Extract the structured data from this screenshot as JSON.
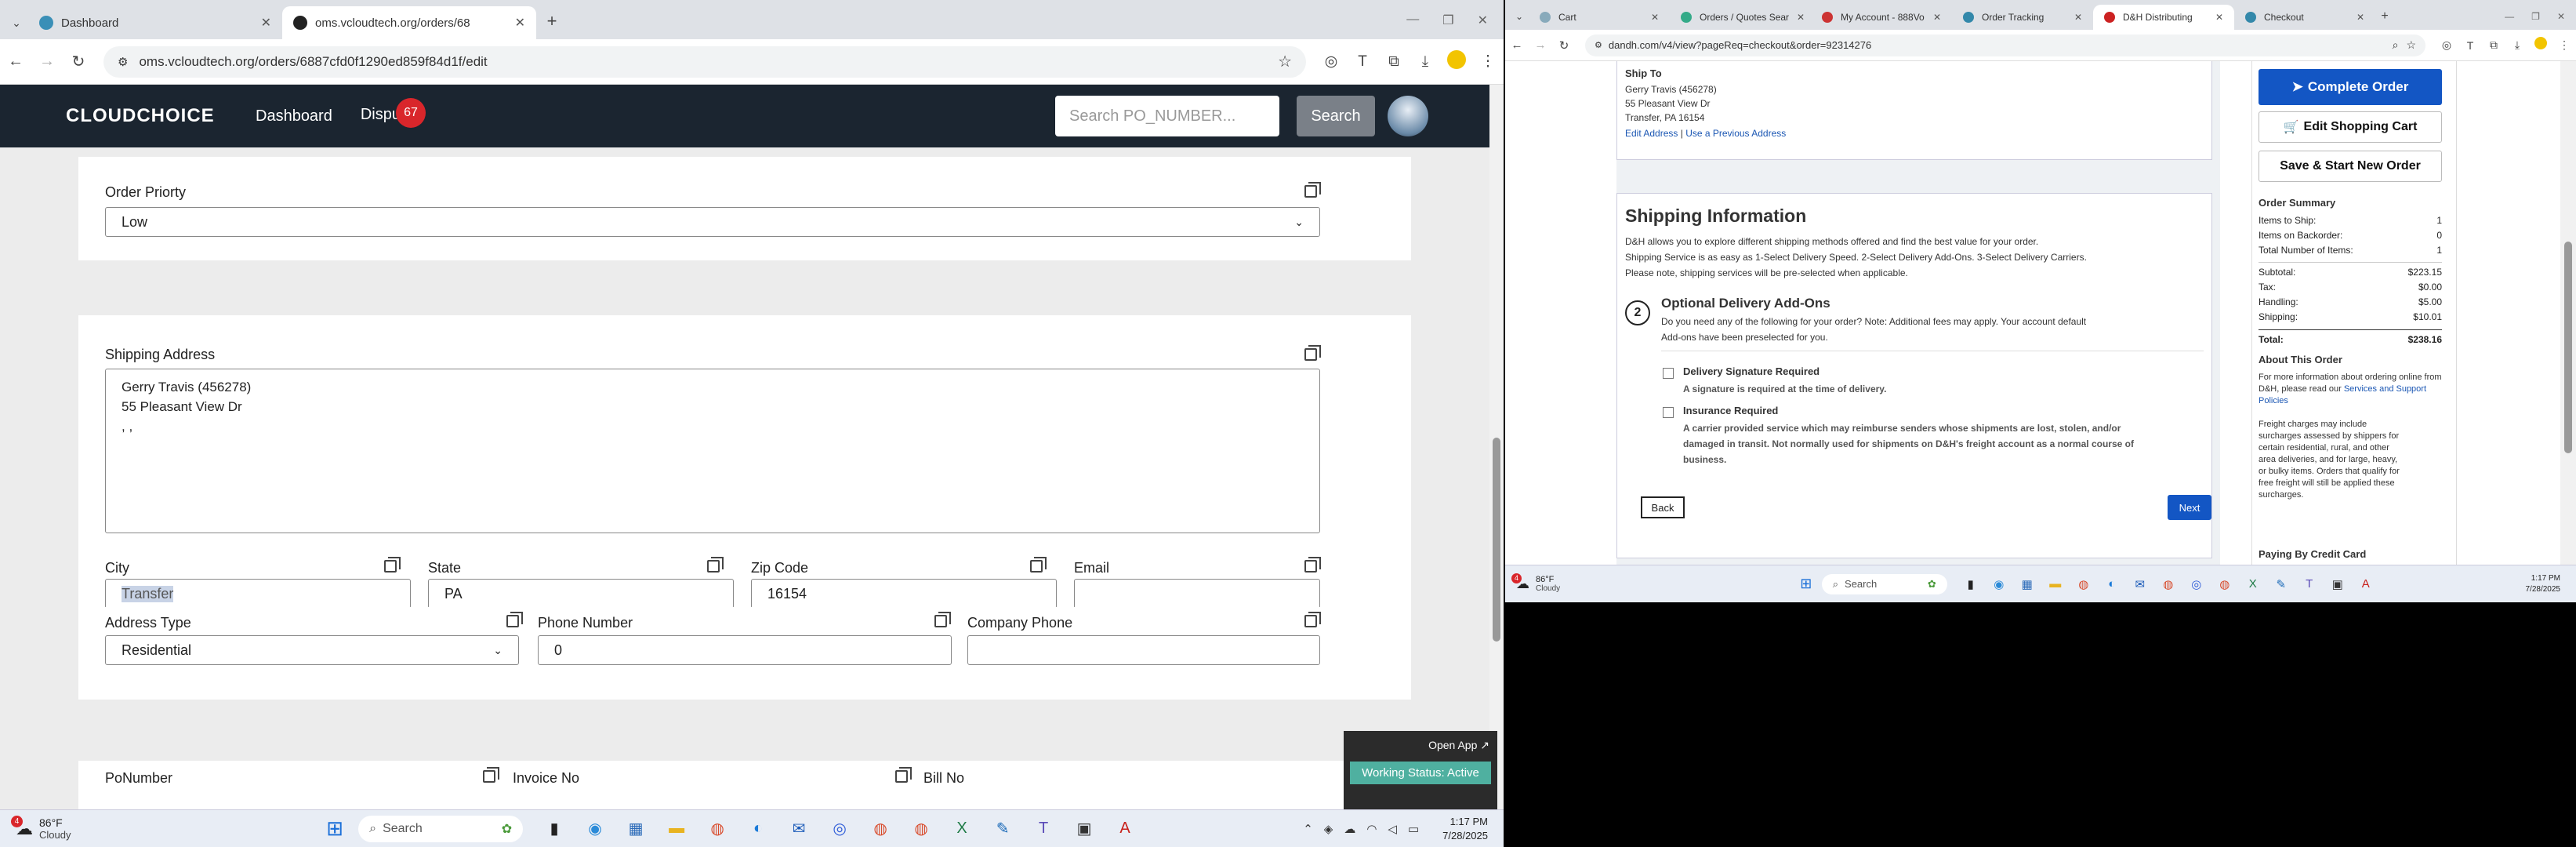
{
  "left": {
    "tabs": [
      {
        "label": "Dashboard",
        "active": false
      },
      {
        "label": "oms.vcloudtech.org/orders/68",
        "active": true
      }
    ],
    "url": "oms.vcloudtech.org/orders/6887cfd0f1290ed859f84d1f/edit",
    "header": {
      "logo": "CLOUDCHOICE",
      "nav_dashboard": "Dashboard",
      "nav_disputes": "Dispu",
      "disputes_count": "67",
      "search_placeholder": "Search PO_NUMBER...",
      "search_button": "Search"
    },
    "order_priority": {
      "label": "Order Priorty",
      "value": "Low"
    },
    "shipping": {
      "label": "Shipping Address",
      "line1": "Gerry Travis (456278)",
      "line2": "55 Pleasant View Dr",
      "line3": ", ,",
      "city_label": "City",
      "city_value": "Transfer",
      "state_label": "State",
      "state_value": "PA",
      "zip_label": "Zip Code",
      "zip_value": "16154",
      "email_label": "Email",
      "email_value": "",
      "address_type_label": "Address Type",
      "address_type_value": "Residential",
      "phone_label": "Phone Number",
      "phone_value": "0",
      "company_phone_label": "Company Phone",
      "company_phone_value": ""
    },
    "bottom_labels": {
      "po": "PoNumber",
      "invoice": "Invoice No",
      "bill": "Bill No"
    },
    "float_panel": {
      "open_app": "Open App ↗",
      "status": "Working Status: Active"
    },
    "taskbar": {
      "temp": "86°F",
      "cond": "Cloudy",
      "search": "Search",
      "time": "1:17 PM",
      "date": "7/28/2025",
      "weather_badge": "4"
    }
  },
  "right": {
    "tabs": [
      "Cart",
      "Orders / Quotes Sear",
      "My Account - 888Vo",
      "Order Tracking",
      "D&H Distributing",
      "Checkout"
    ],
    "active_tab_index": 4,
    "url": "dandh.com/v4/view?pageReq=checkout&order=92314276",
    "ship_to": {
      "title": "Ship To",
      "line1": "Gerry Travis (456278)",
      "line2": "55 Pleasant View Dr",
      "line3": "Transfer, PA 16154",
      "edit": "Edit Address",
      "sep": "|",
      "previous": "Use a Previous Address"
    },
    "shipping_info": {
      "title": "Shipping Information",
      "p1": "D&H allows you to explore different shipping methods offered and find the best value for your order.",
      "p2": "Shipping Service is as easy as 1-Select Delivery Speed. 2-Select Delivery Add-Ons. 3-Select Delivery Carriers.",
      "p3": "Please note, shipping services will be pre-selected when applicable.",
      "step": "2",
      "addons_title": "Optional Delivery Add-Ons",
      "addons_desc1": "Do you need any of the following for your order? Note: Additional fees may apply. Your account default",
      "addons_desc2": "Add-ons have been preselected for you.",
      "sig_title": "Delivery Signature Required",
      "sig_desc": "A signature is required at the time of delivery.",
      "ins_title": "Insurance Required",
      "ins_desc1": "A carrier provided service which may reimburse senders whose shipments are lost, stolen, and/or",
      "ins_desc2": "damaged in transit. Not normally used for shipments on D&H's freight account as a normal course of",
      "ins_desc3": "business.",
      "back": "Back",
      "next": "Next"
    },
    "sidebar": {
      "complete": "Complete Order",
      "edit_cart": "Edit Shopping Cart",
      "save_new": "Save & Start New Order",
      "summary_title": "Order Summary",
      "rows1": [
        {
          "label": "Items to Ship:",
          "value": "1"
        },
        {
          "label": "Items on Backorder:",
          "value": "0"
        },
        {
          "label": "Total Number of Items:",
          "value": "1"
        }
      ],
      "rows2": [
        {
          "label": "Subtotal:",
          "value": "$223.15"
        },
        {
          "label": "Tax:",
          "value": "$0.00"
        },
        {
          "label": "Handling:",
          "value": "$5.00"
        },
        {
          "label": "Shipping:",
          "value": "$10.01"
        }
      ],
      "total_label": "Total:",
      "total_value": "$238.16",
      "about_title": "About This Order",
      "about_p1": "For more information about ordering online from D&H, please read our",
      "about_link": "Services and Support Policies",
      "about_p2a": "Freight charges may include",
      "about_p2b": "surcharges assessed by shippers for",
      "about_p2c": "certain residential, rural, and other",
      "about_p2d": "area deliveries, and for large, heavy,",
      "about_p2e": "or bulky items. Orders that qualify for",
      "about_p2f": "free freight will still be applied these",
      "about_p2g": "surcharges.",
      "paying": "Paying By Credit Card"
    },
    "taskbar": {
      "temp": "86°F",
      "cond": "Cloudy",
      "search": "Search",
      "time": "1:17 PM",
      "date": "7/28/2025",
      "weather_badge": "4"
    }
  },
  "colors": {
    "header_bg": "#1b2530",
    "badge": "#d9262b",
    "dh_blue": "#1356c4"
  }
}
